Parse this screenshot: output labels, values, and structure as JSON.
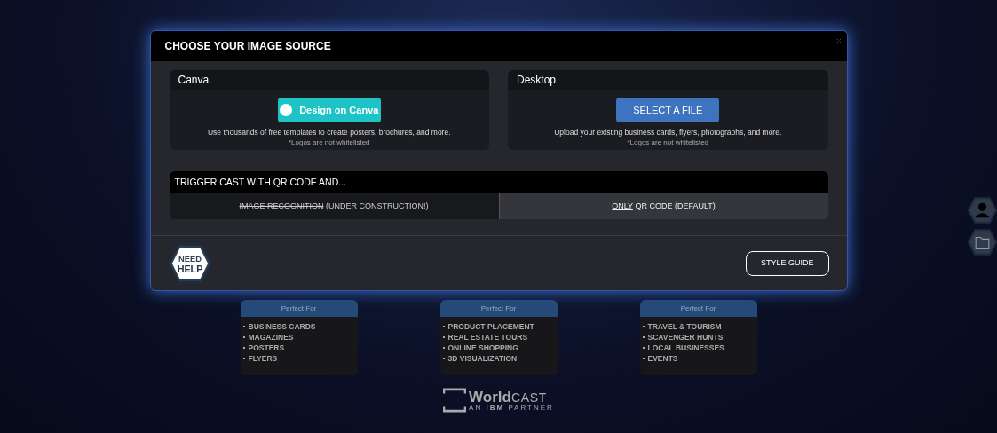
{
  "modal": {
    "title": "CHOOSE YOUR IMAGE SOURCE",
    "sources": [
      {
        "kind": "canva",
        "heading": "Canva",
        "button": "Design on Canva",
        "description": "Use thousands of free templates to create posters, brochures, and more.",
        "note": "*Logos are not whitelisted"
      },
      {
        "kind": "file",
        "heading": "Desktop",
        "button": "SELECT A FILE",
        "description": "Upload your existing business cards, flyers, photographs, and more.",
        "note": "*Logos are not whitelisted"
      }
    ],
    "trigger": {
      "heading": "TRIGGER CAST WITH QR CODE AND...",
      "options": [
        {
          "emphasis": "IMAGE RECOGNITION",
          "struck": true,
          "underlined": false,
          "rest": "(UNDER CONSTRUCTION!)",
          "selected": false
        },
        {
          "emphasis": "ONLY",
          "struck": false,
          "underlined": true,
          "rest": "QR CODE (DEFAULT)",
          "selected": true
        }
      ]
    },
    "help": {
      "top": "NEED",
      "bottom": "HELP"
    },
    "style_guide": "STYLE GUIDE"
  },
  "perfect_for": [
    {
      "heading": "Perfect For",
      "items": [
        "BUSINESS CARDS",
        "MAGAZINES",
        "POSTERS",
        "FLYERS"
      ]
    },
    {
      "heading": "Perfect For",
      "items": [
        "PRODUCT PLACEMENT",
        "REAL ESTATE TOURS",
        "ONLINE SHOPPING",
        "3D VISUALIZATION"
      ]
    },
    {
      "heading": "Perfect For",
      "items": [
        "TRAVEL & TOURISM",
        "SCAVENGER HUNTS",
        "LOCAL BUSINESSES",
        "EVENTS"
      ]
    }
  ],
  "logo": {
    "brand_bold": "World",
    "brand_light": "CAST",
    "tagline_start": "AN",
    "tagline_partner": "IBM",
    "tagline_end": "PARTNER"
  }
}
